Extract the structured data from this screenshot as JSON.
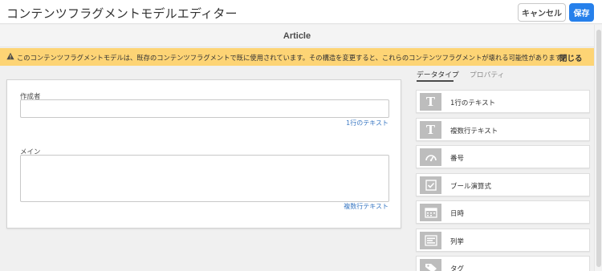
{
  "header": {
    "title": "コンテンツフラグメントモデルエディター",
    "cancel_label": "キャンセル",
    "save_label": "保存"
  },
  "model": {
    "title": "Article"
  },
  "warning": {
    "icon": "warning-icon",
    "text": "このコンテンツフラグメントモデルは、既存のコンテンツフラグメントで既に使用されています。その構造を変更すると、これらのコンテンツフラグメントが壊れる可能性があります。",
    "close_label": "閉じる"
  },
  "editor": {
    "fields": [
      {
        "label": "作成者",
        "value": "",
        "type_label": "1行のテキスト"
      },
      {
        "label": "メイン",
        "value": "",
        "type_label": "複数行テキスト"
      }
    ]
  },
  "sidebar": {
    "tabs": [
      {
        "label": "データタイプ",
        "active": true
      },
      {
        "label": "プロパティ",
        "active": false
      }
    ],
    "datatypes": [
      {
        "label": "1行のテキスト",
        "icon": "text-t-icon"
      },
      {
        "label": "複数行テキスト",
        "icon": "text-t-icon"
      },
      {
        "label": "番号",
        "icon": "gauge-icon"
      },
      {
        "label": "ブール演算式",
        "icon": "checkbox-icon"
      },
      {
        "label": "日時",
        "icon": "calendar-icon"
      },
      {
        "label": "列挙",
        "icon": "list-icon"
      },
      {
        "label": "タグ",
        "icon": "tag-icon"
      }
    ]
  },
  "colors": {
    "accent": "#2680eb",
    "warning_bg": "#fdd475",
    "link": "#3a78c3"
  }
}
